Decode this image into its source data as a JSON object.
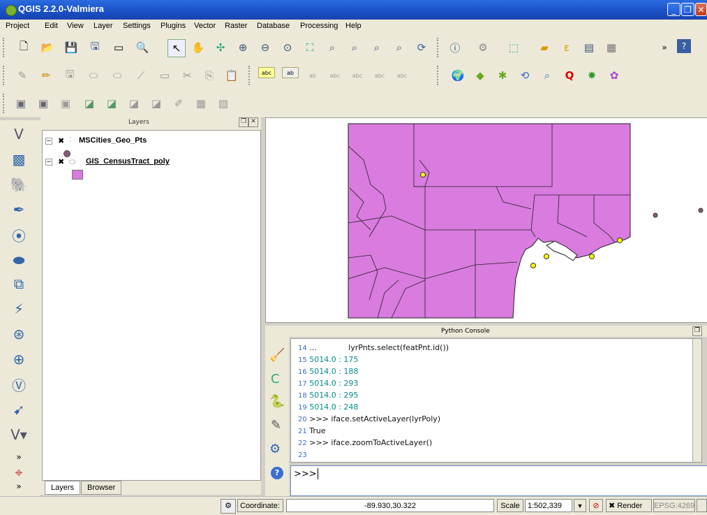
{
  "window": {
    "title": "QGIS 2.2.0-Valmiera"
  },
  "menu": [
    "Project",
    "Edit",
    "View",
    "Layer",
    "Settings",
    "Plugins",
    "Vector",
    "Raster",
    "Database",
    "Processing",
    "Help"
  ],
  "layers_panel": {
    "title": "Layers",
    "items": [
      {
        "name": "MSCities_Geo_Pts",
        "checked": true
      },
      {
        "name": "GIS_CensusTract_poly",
        "checked": true
      }
    ],
    "tabs": [
      "Layers",
      "Browser"
    ]
  },
  "console": {
    "title": "Python Console",
    "lines": [
      {
        "n": "14",
        "text": "...             lyrPnts.select(featPnt.id())"
      },
      {
        "n": "15",
        "text": "5014.0 : 175"
      },
      {
        "n": "16",
        "text": "5014.0 : 188"
      },
      {
        "n": "17",
        "text": "5014.0 : 293"
      },
      {
        "n": "18",
        "text": "5014.0 : 295"
      },
      {
        "n": "19",
        "text": "5014.0 : 248"
      },
      {
        "n": "20",
        "text": ">>> iface.setActiveLayer(lyrPoly)"
      },
      {
        "n": "21",
        "text": "True"
      },
      {
        "n": "22",
        "text": ">>> iface.zoomToActiveLayer()"
      },
      {
        "n": "23",
        "text": ""
      }
    ],
    "prompt": ">>>"
  },
  "status": {
    "coordinate_label": "Coordinate:",
    "coordinate_value": "-89.930,30.322",
    "scale_label": "Scale",
    "scale_value": "1:502,339",
    "render_label": "Render",
    "epsg": "EPSG:4269"
  },
  "colors": {
    "polygon_fill": "#d97bdf",
    "point_fill": "#ffff00",
    "layer_point": "#8b5a7a"
  }
}
